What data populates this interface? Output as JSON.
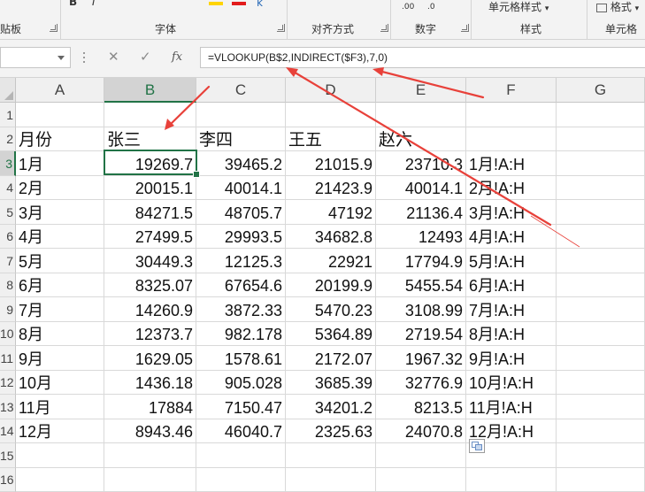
{
  "ribbon": {
    "groups": [
      {
        "label": "剪贴板",
        "visible": "贴板"
      },
      {
        "label": "字体"
      },
      {
        "label": "对齐方式"
      },
      {
        "label": "数字"
      },
      {
        "label": "样式"
      },
      {
        "label": "单元格"
      }
    ],
    "format_as_table_label": "单元格样式",
    "format_label": "格式"
  },
  "formula_bar": {
    "name_box": "",
    "cancel_glyph": "✕",
    "enter_glyph": "✓",
    "fx_glyph": "fx",
    "formula": "=VLOOKUP(B$2,INDIRECT($F3),7,0)"
  },
  "sheet": {
    "columns": [
      "A",
      "B",
      "C",
      "D",
      "E",
      "F",
      "G"
    ],
    "selected_column": "B",
    "row_numbers": [
      "1",
      "2",
      "3",
      "4",
      "5",
      "6",
      "7",
      "8",
      "9",
      "10",
      "11",
      "12",
      "13",
      "14",
      "15",
      "16"
    ],
    "header_row": [
      "月份",
      "张三",
      "李四",
      "王五",
      "赵六",
      "",
      ""
    ],
    "rows": [
      [
        "1月",
        "19269.7",
        "39465.2",
        "21015.9",
        "23710.3",
        "1月!A:H"
      ],
      [
        "2月",
        "20015.1",
        "40014.1",
        "21423.9",
        "40014.1",
        "2月!A:H"
      ],
      [
        "3月",
        "84271.5",
        "48705.7",
        "47192",
        "21136.4",
        "3月!A:H"
      ],
      [
        "4月",
        "27499.5",
        "29993.5",
        "34682.8",
        "12493",
        "4月!A:H"
      ],
      [
        "5月",
        "30449.3",
        "12125.3",
        "22921",
        "17794.9",
        "5月!A:H"
      ],
      [
        "6月",
        "8325.07",
        "67654.6",
        "20199.9",
        "5455.54",
        "6月!A:H"
      ],
      [
        "7月",
        "14260.9",
        "3872.33",
        "5470.23",
        "3108.99",
        "7月!A:H"
      ],
      [
        "8月",
        "12373.7",
        "982.178",
        "5364.89",
        "2719.54",
        "8月!A:H"
      ],
      [
        "9月",
        "1629.05",
        "1578.61",
        "2172.07",
        "1967.32",
        "9月!A:H"
      ],
      [
        "10月",
        "1436.18",
        "905.028",
        "3685.39",
        "32776.9",
        "10月!A:H"
      ],
      [
        "11月",
        "17884",
        "7150.47",
        "34201.2",
        "8213.5",
        "11月!A:H"
      ],
      [
        "12月",
        "8943.46",
        "46040.7",
        "2325.63",
        "24070.8",
        "12月!A:H"
      ]
    ],
    "active_cell": "B3"
  },
  "colors": {
    "excel_green": "#217346",
    "annotation_red": "#e8413a"
  }
}
